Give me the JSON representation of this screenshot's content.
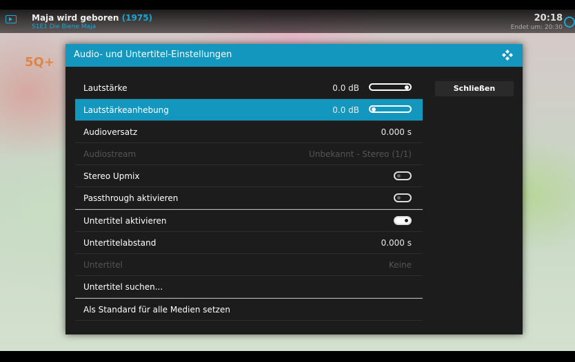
{
  "topbar": {
    "title": "Maja wird geboren",
    "year": "(1975)",
    "episode": "S1E1 Die Biene Maja",
    "clock": "20:18",
    "end_time": "Endet um: 20:30"
  },
  "background": {
    "logo": "5Q+"
  },
  "dialog": {
    "title": "Audio- und Untertitel-Einstellungen",
    "close_label": "Schließen",
    "accent_color": "#1497be",
    "rows": [
      {
        "label": "Lautstärke",
        "value": "0.0 dB",
        "control": "slider",
        "level": 1.0
      },
      {
        "label": "Lautstärkeanhebung",
        "value": "0.0 dB",
        "control": "slider",
        "level": 0.0,
        "focused": true
      },
      {
        "label": "Audioversatz",
        "value": "0.000 s"
      },
      {
        "label": "Audiostream",
        "value": "Unbekannt - Stereo (1/1)",
        "disabled": true
      },
      {
        "label": "Stereo Upmix",
        "control": "toggle",
        "state": "off"
      },
      {
        "label": "Passthrough aktivieren",
        "control": "toggle",
        "state": "off"
      },
      {
        "label": "Untertitel aktivieren",
        "control": "toggle",
        "state": "on"
      },
      {
        "label": "Untertitelabstand",
        "value": "0.000 s"
      },
      {
        "label": "Untertitel",
        "value": "Keine",
        "disabled": true
      },
      {
        "label": "Untertitel suchen..."
      },
      {
        "label": "Als Standard für alle Medien setzen"
      }
    ]
  },
  "icons": [
    "tv-icon",
    "clock-icon",
    "kodi-logo-icon"
  ]
}
